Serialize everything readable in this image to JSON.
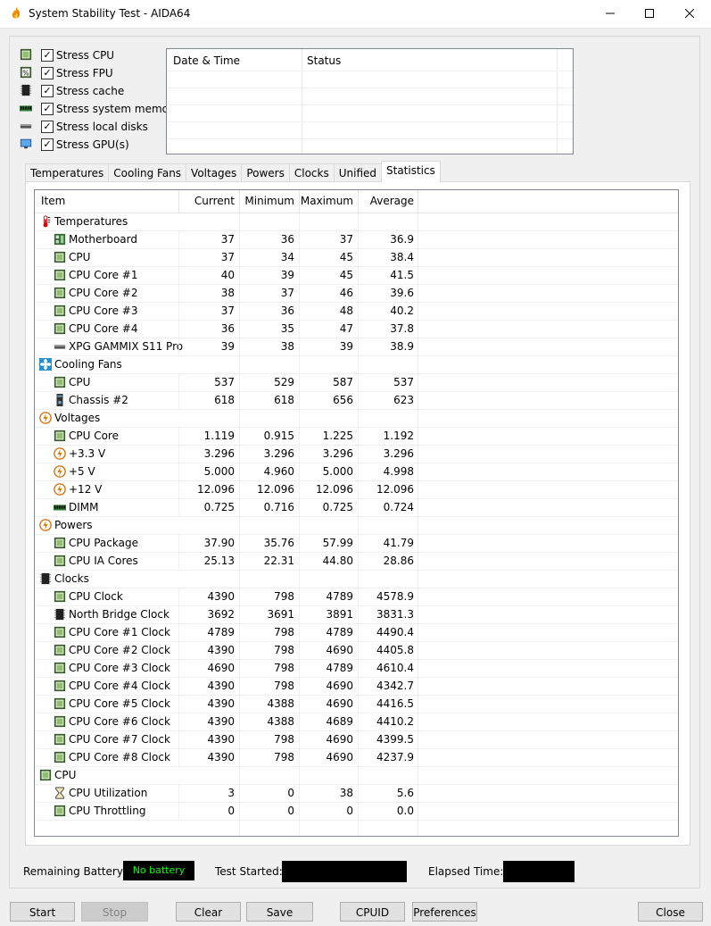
{
  "window": {
    "title": "System Stability Test - AIDA64",
    "minimize": "—",
    "maximize": "☐",
    "close": "✕"
  },
  "stress_options": [
    {
      "label": "Stress CPU",
      "checked": true,
      "icon": "cpu-chip-icon"
    },
    {
      "label": "Stress FPU",
      "checked": true,
      "icon": "fpu-percent-icon"
    },
    {
      "label": "Stress cache",
      "checked": true,
      "icon": "cache-chip-icon"
    },
    {
      "label": "Stress system memory",
      "checked": true,
      "icon": "memory-module-icon"
    },
    {
      "label": "Stress local disks",
      "checked": true,
      "icon": "disk-drive-icon"
    },
    {
      "label": "Stress GPU(s)",
      "checked": true,
      "icon": "monitor-icon"
    }
  ],
  "log": {
    "col_datetime": "Date & Time",
    "col_status": "Status"
  },
  "tabs": [
    "Temperatures",
    "Cooling Fans",
    "Voltages",
    "Powers",
    "Clocks",
    "Unified",
    "Statistics"
  ],
  "active_tab": "Statistics",
  "grid": {
    "headers": {
      "item": "Item",
      "current": "Current",
      "minimum": "Minimum",
      "maximum": "Maximum",
      "average": "Average"
    },
    "rows": [
      {
        "type": "group",
        "label": "Temperatures",
        "icon": "thermometer-icon"
      },
      {
        "type": "item",
        "label": "Motherboard",
        "icon": "motherboard-icon",
        "cur": "37",
        "min": "36",
        "max": "37",
        "avg": "36.9"
      },
      {
        "type": "item",
        "label": "CPU",
        "icon": "cpu-chip-icon",
        "cur": "37",
        "min": "34",
        "max": "45",
        "avg": "38.4"
      },
      {
        "type": "item",
        "label": "CPU Core #1",
        "icon": "cpu-chip-icon",
        "cur": "40",
        "min": "39",
        "max": "45",
        "avg": "41.5"
      },
      {
        "type": "item",
        "label": "CPU Core #2",
        "icon": "cpu-chip-icon",
        "cur": "38",
        "min": "37",
        "max": "46",
        "avg": "39.6"
      },
      {
        "type": "item",
        "label": "CPU Core #3",
        "icon": "cpu-chip-icon",
        "cur": "37",
        "min": "36",
        "max": "48",
        "avg": "40.2"
      },
      {
        "type": "item",
        "label": "CPU Core #4",
        "icon": "cpu-chip-icon",
        "cur": "36",
        "min": "35",
        "max": "47",
        "avg": "37.8"
      },
      {
        "type": "item",
        "label": "XPG GAMMIX S11 Pro",
        "icon": "disk-drive-icon",
        "cur": "39",
        "min": "38",
        "max": "39",
        "avg": "38.9"
      },
      {
        "type": "group",
        "label": "Cooling Fans",
        "icon": "fan-icon"
      },
      {
        "type": "item",
        "label": "CPU",
        "icon": "cpu-chip-icon",
        "cur": "537",
        "min": "529",
        "max": "587",
        "avg": "537"
      },
      {
        "type": "item",
        "label": "Chassis #2",
        "icon": "chassis-icon",
        "cur": "618",
        "min": "618",
        "max": "656",
        "avg": "623"
      },
      {
        "type": "group",
        "label": "Voltages",
        "icon": "voltage-icon"
      },
      {
        "type": "item",
        "label": "CPU Core",
        "icon": "cpu-chip-icon",
        "cur": "1.119",
        "min": "0.915",
        "max": "1.225",
        "avg": "1.192"
      },
      {
        "type": "item",
        "label": "+3.3 V",
        "icon": "voltage-icon",
        "cur": "3.296",
        "min": "3.296",
        "max": "3.296",
        "avg": "3.296"
      },
      {
        "type": "item",
        "label": "+5 V",
        "icon": "voltage-icon",
        "cur": "5.000",
        "min": "4.960",
        "max": "5.000",
        "avg": "4.998"
      },
      {
        "type": "item",
        "label": "+12 V",
        "icon": "voltage-icon",
        "cur": "12.096",
        "min": "12.096",
        "max": "12.096",
        "avg": "12.096"
      },
      {
        "type": "item",
        "label": "DIMM",
        "icon": "memory-module-icon",
        "cur": "0.725",
        "min": "0.716",
        "max": "0.725",
        "avg": "0.724"
      },
      {
        "type": "group",
        "label": "Powers",
        "icon": "voltage-icon"
      },
      {
        "type": "item",
        "label": "CPU Package",
        "icon": "cpu-chip-icon",
        "cur": "37.90",
        "min": "35.76",
        "max": "57.99",
        "avg": "41.79"
      },
      {
        "type": "item",
        "label": "CPU IA Cores",
        "icon": "cpu-chip-icon",
        "cur": "25.13",
        "min": "22.31",
        "max": "44.80",
        "avg": "28.86"
      },
      {
        "type": "group",
        "label": "Clocks",
        "icon": "cache-chip-icon"
      },
      {
        "type": "item",
        "label": "CPU Clock",
        "icon": "cpu-chip-icon",
        "cur": "4390",
        "min": "798",
        "max": "4789",
        "avg": "4578.9"
      },
      {
        "type": "item",
        "label": "North Bridge Clock",
        "icon": "cache-chip-icon",
        "cur": "3692",
        "min": "3691",
        "max": "3891",
        "avg": "3831.3"
      },
      {
        "type": "item",
        "label": "CPU Core #1 Clock",
        "icon": "cpu-chip-icon",
        "cur": "4789",
        "min": "798",
        "max": "4789",
        "avg": "4490.4"
      },
      {
        "type": "item",
        "label": "CPU Core #2 Clock",
        "icon": "cpu-chip-icon",
        "cur": "4390",
        "min": "798",
        "max": "4690",
        "avg": "4405.8"
      },
      {
        "type": "item",
        "label": "CPU Core #3 Clock",
        "icon": "cpu-chip-icon",
        "cur": "4690",
        "min": "798",
        "max": "4789",
        "avg": "4610.4"
      },
      {
        "type": "item",
        "label": "CPU Core #4 Clock",
        "icon": "cpu-chip-icon",
        "cur": "4390",
        "min": "798",
        "max": "4690",
        "avg": "4342.7"
      },
      {
        "type": "item",
        "label": "CPU Core #5 Clock",
        "icon": "cpu-chip-icon",
        "cur": "4390",
        "min": "4388",
        "max": "4690",
        "avg": "4416.5"
      },
      {
        "type": "item",
        "label": "CPU Core #6 Clock",
        "icon": "cpu-chip-icon",
        "cur": "4390",
        "min": "4388",
        "max": "4689",
        "avg": "4410.2"
      },
      {
        "type": "item",
        "label": "CPU Core #7 Clock",
        "icon": "cpu-chip-icon",
        "cur": "4390",
        "min": "798",
        "max": "4690",
        "avg": "4399.5"
      },
      {
        "type": "item",
        "label": "CPU Core #8 Clock",
        "icon": "cpu-chip-icon",
        "cur": "4390",
        "min": "798",
        "max": "4690",
        "avg": "4237.9"
      },
      {
        "type": "group",
        "label": "CPU",
        "icon": "cpu-chip-icon"
      },
      {
        "type": "item",
        "label": "CPU Utilization",
        "icon": "hourglass-icon",
        "cur": "3",
        "min": "0",
        "max": "38",
        "avg": "5.6"
      },
      {
        "type": "item",
        "label": "CPU Throttling",
        "icon": "cpu-chip-icon",
        "cur": "0",
        "min": "0",
        "max": "0",
        "avg": "0.0"
      }
    ]
  },
  "status": {
    "battery_label": "Remaining Battery:",
    "battery_value": "No battery",
    "test_started_label": "Test Started:",
    "elapsed_label": "Elapsed Time:"
  },
  "buttons": {
    "start": "Start",
    "stop": "Stop",
    "clear": "Clear",
    "save": "Save",
    "cpuid": "CPUID",
    "preferences": "Preferences",
    "close": "Close"
  },
  "colors": {
    "battery_text": "#00ff00",
    "status_box": "#000000"
  }
}
